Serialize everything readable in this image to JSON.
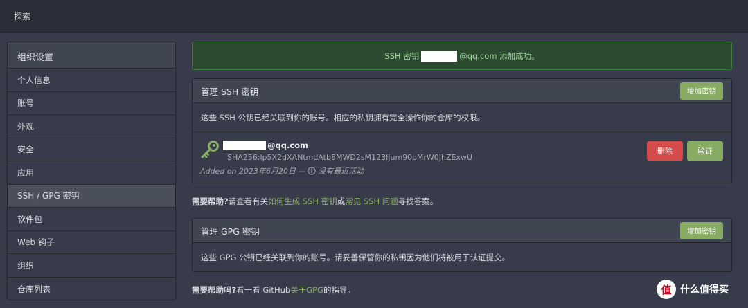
{
  "topbar": {
    "explore": "探索"
  },
  "sidebar": {
    "header": "组织设置",
    "items": [
      {
        "label": "个人信息"
      },
      {
        "label": "账号"
      },
      {
        "label": "外观"
      },
      {
        "label": "安全"
      },
      {
        "label": "应用"
      },
      {
        "label": "SSH / GPG 密钥",
        "active": true
      },
      {
        "label": "软件包"
      },
      {
        "label": "Web 钩子"
      },
      {
        "label": "组织"
      },
      {
        "label": "仓库列表"
      }
    ]
  },
  "alert": {
    "prefix": "SSH 密钥 ",
    "suffix": "@qq.com 添加成功。"
  },
  "ssh": {
    "title": "管理 SSH 密钥",
    "add_button": "增加密钥",
    "description": "这些 SSH 公钥已经关联到你的账号。相应的私钥拥有完全操作你的仓库的权限。",
    "key": {
      "email_suffix": "@qq.com",
      "fingerprint": "SHA256:lp5X2dXANtmdAtb8MWD2sM123IJum90oMrW0JhZExwU",
      "added": "Added on 2023年6月20日 —",
      "activity": "没有最近活动",
      "delete_button": "删除",
      "verify_button": "验证"
    }
  },
  "ssh_help": {
    "label": "需要帮助?",
    "text1": " 请查看有关 ",
    "link1": "如何生成 SSH 密钥",
    "text2": " 或 ",
    "link2": "常见 SSH 问题",
    "text3": " 寻找答案。"
  },
  "gpg": {
    "title": "管理 GPG 密钥",
    "add_button": "增加密钥",
    "description": "这些 GPG 公钥已经关联到你的账号。请妥善保管你的私钥因为他们将被用于认证提交。"
  },
  "gpg_help": {
    "label": "需要帮助吗?",
    "text1": " 看一看 GitHub ",
    "link1": "关于GPG",
    "text2": " 的指导。"
  },
  "watermark": {
    "badge": "值",
    "text": "什么值得买"
  },
  "colors": {
    "accent": "#87ab63",
    "danger": "#d34b4b",
    "background": "#383c4a"
  }
}
